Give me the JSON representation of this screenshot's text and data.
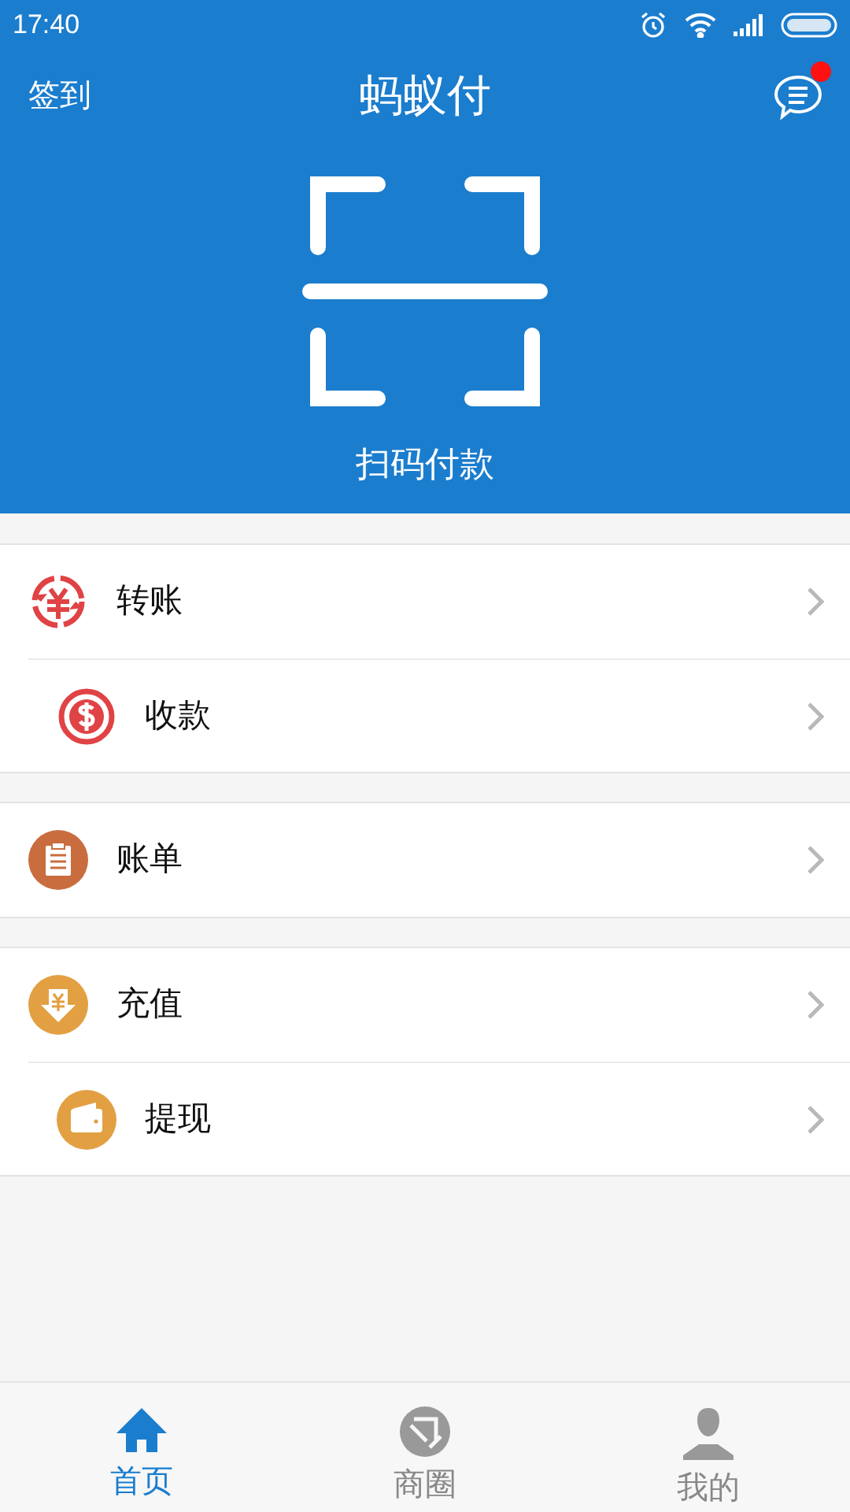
{
  "status_bar": {
    "time": "17:40"
  },
  "header": {
    "left_action": "签到",
    "title": "蚂蚁付",
    "messages_unread": true,
    "scan_label": "扫码付款"
  },
  "menu_groups": [
    {
      "items": [
        {
          "kind": "transfer",
          "label": "转账",
          "color": "#e04345"
        },
        {
          "kind": "receive",
          "label": "收款",
          "color": "#e04345"
        }
      ]
    },
    {
      "items": [
        {
          "kind": "bill",
          "label": "账单",
          "color": "#c96d3f"
        }
      ]
    },
    {
      "items": [
        {
          "kind": "topup",
          "label": "充值",
          "color": "#e2a043"
        },
        {
          "kind": "withdraw",
          "label": "提现",
          "color": "#e2a043"
        }
      ]
    }
  ],
  "tabs": [
    {
      "kind": "home",
      "label": "首页",
      "selected": true
    },
    {
      "kind": "circle",
      "label": "商圈",
      "selected": false
    },
    {
      "kind": "me",
      "label": "我的",
      "selected": false
    }
  ]
}
